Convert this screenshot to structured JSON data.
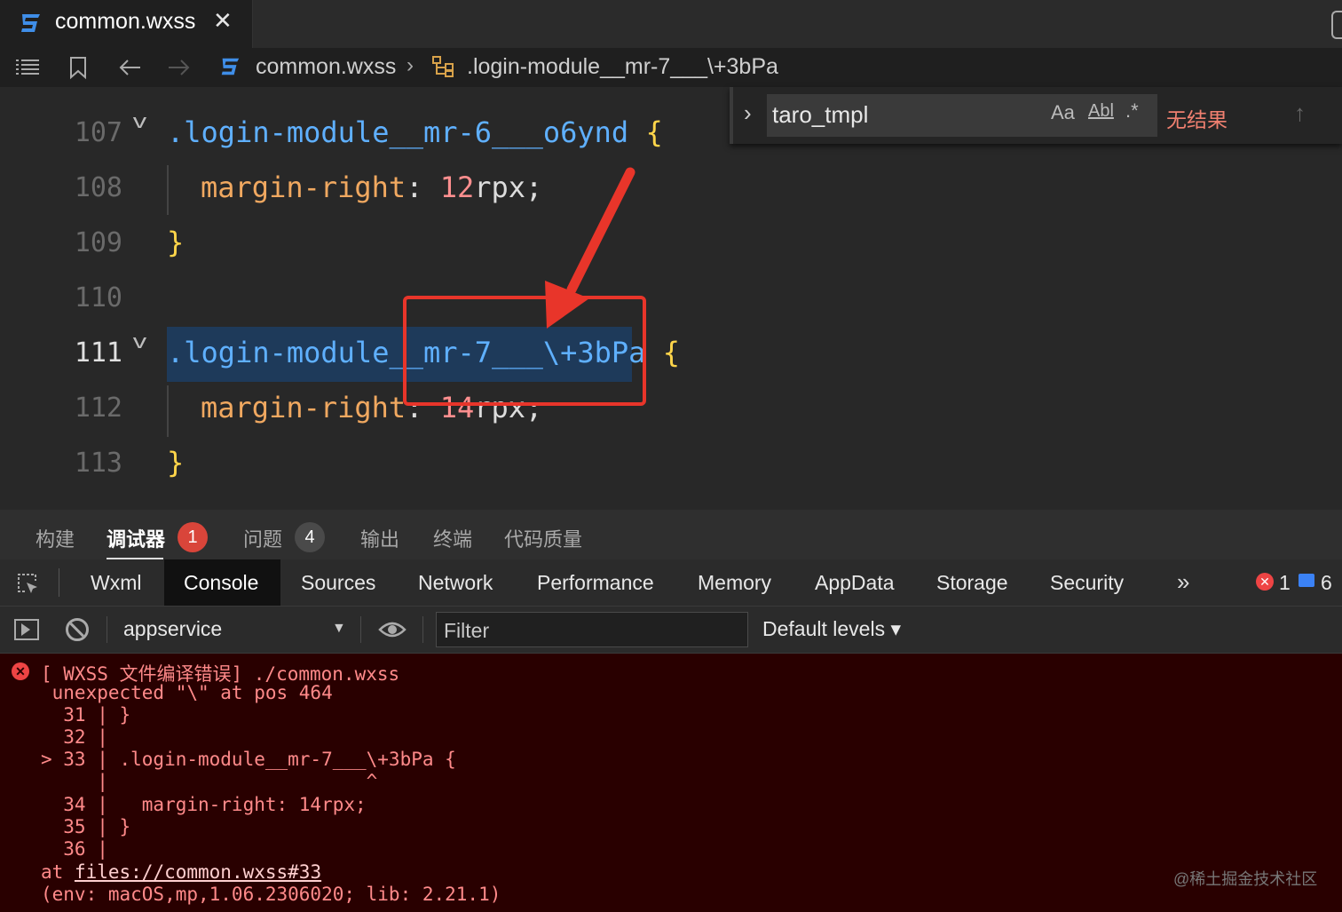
{
  "tab": {
    "title": "common.wxss",
    "close": "✕"
  },
  "breadcrumb": {
    "file": "common.wxss",
    "separator": "›",
    "selector": ".login-module__mr-7___\\+3bPa"
  },
  "editor": {
    "lines": [
      {
        "num": "107",
        "selector": ".login-module__mr-6___o6ynd",
        "brace": "{"
      },
      {
        "num": "108",
        "prop": "margin-right",
        "colon": ": ",
        "value": "12",
        "unit": "rpx;"
      },
      {
        "num": "109",
        "brace": "}"
      },
      {
        "num": "110"
      },
      {
        "num": "111",
        "selector": ".login-module__mr-7___\\+3bPa",
        "brace": "{"
      },
      {
        "num": "112",
        "prop": "margin-right",
        "colon": ": ",
        "value": "14",
        "unit": "rpx;"
      },
      {
        "num": "113",
        "brace": "}"
      }
    ]
  },
  "find": {
    "value": "taro_tmpl",
    "match_case": "Aa",
    "whole_word": "Abl",
    "regex": ".*",
    "result": "无结果"
  },
  "panel_tabs": {
    "build": "构建",
    "debugger": "调试器",
    "debugger_badge": "1",
    "problems": "问题",
    "problems_badge": "4",
    "output": "输出",
    "terminal": "终端",
    "quality": "代码质量"
  },
  "devtools_tabs": [
    "Wxml",
    "Console",
    "Sources",
    "Network",
    "Performance",
    "Memory",
    "AppData",
    "Storage",
    "Security"
  ],
  "devtools_status": {
    "more": "»",
    "errors": "1",
    "messages": "6"
  },
  "console_toolbar": {
    "context": "appservice",
    "filter_placeholder": "Filter",
    "levels": "Default levels ▾"
  },
  "console": {
    "lines": [
      "[ WXSS 文件编译错误] ./common.wxss",
      " unexpected \"\\\" at pos 464",
      "  31 | }",
      "  32 |",
      "> 33 | .login-module__mr-7___\\+3bPa {",
      "     |                       ^",
      "  34 |   margin-right: 14rpx;",
      "  35 | }",
      "  36 |"
    ],
    "at_prefix": "at ",
    "at_link": "files://common.wxss#33",
    "env": "(env: macOS,mp,1.06.2306020; lib: 2.21.1)"
  },
  "watermark": "@稀土掘金技术社区",
  "colors": {
    "annotation_red": "#e8352a",
    "error_bg": "#290000",
    "selector_blue": "#5fb0ff"
  }
}
